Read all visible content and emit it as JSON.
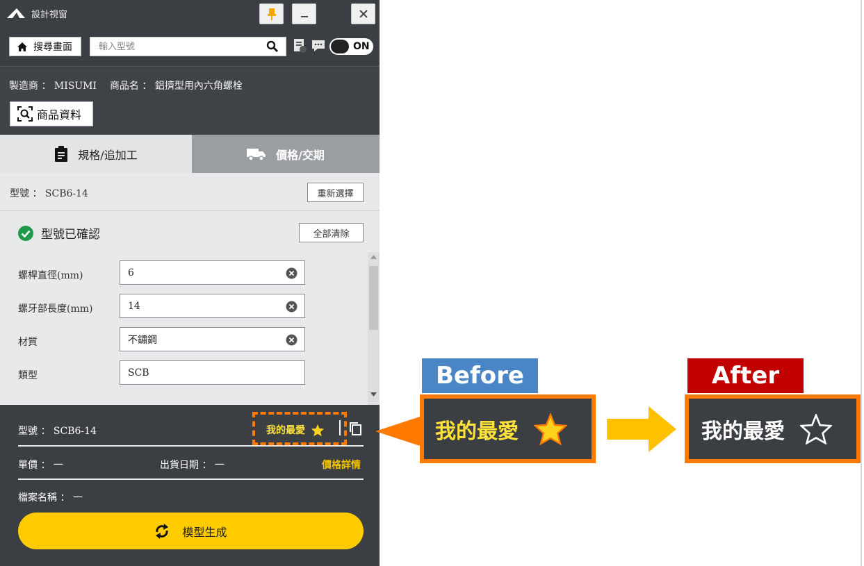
{
  "window": {
    "title": "設計視窗"
  },
  "search": {
    "home_label": "搜尋畫面",
    "placeholder": "輸入型號",
    "toggle_label": "ON"
  },
  "product": {
    "maker_label": "製造商",
    "maker_sep": "：",
    "maker_value": "MISUMI",
    "name_label": "商品名",
    "name_sep": "：",
    "name_value": "鋁擠型用內六角螺栓",
    "info_button": "商品資料"
  },
  "tabs": {
    "spec": "規格/追加工",
    "price": "價格/交期"
  },
  "spec": {
    "model_text": "型號 ： SCB6-14",
    "reselect_button": "重新選擇",
    "confirmed_label": "型號已確認",
    "clear_all_button": "全部清除",
    "fields": [
      {
        "label": "螺桿直徑(mm)",
        "value": "6"
      },
      {
        "label": "螺牙部長度(mm)",
        "value": "14"
      },
      {
        "label": "材質",
        "value": "不鏽鋼"
      },
      {
        "label": "類型",
        "value": "SCB"
      }
    ]
  },
  "summary": {
    "model_text": "型號 ： SCB6-14",
    "favorite_label": "我的最愛",
    "unit_price": "單價 ： 一",
    "ship_date": "出貨日期 ： 一",
    "price_detail": "價格詳情",
    "file_name": "檔案名稱 ： 一",
    "generate_button": "模型生成"
  },
  "annotation": {
    "before_label": "Before",
    "after_label": "After",
    "before_text": "我的最愛",
    "after_text": "我的最愛"
  },
  "colors": {
    "accent_yellow": "#ffcc00",
    "annotation_orange": "#ff7a00",
    "before_blue": "#4a86c5",
    "after_red": "#c10000",
    "dark_panel": "#3b3f43"
  }
}
